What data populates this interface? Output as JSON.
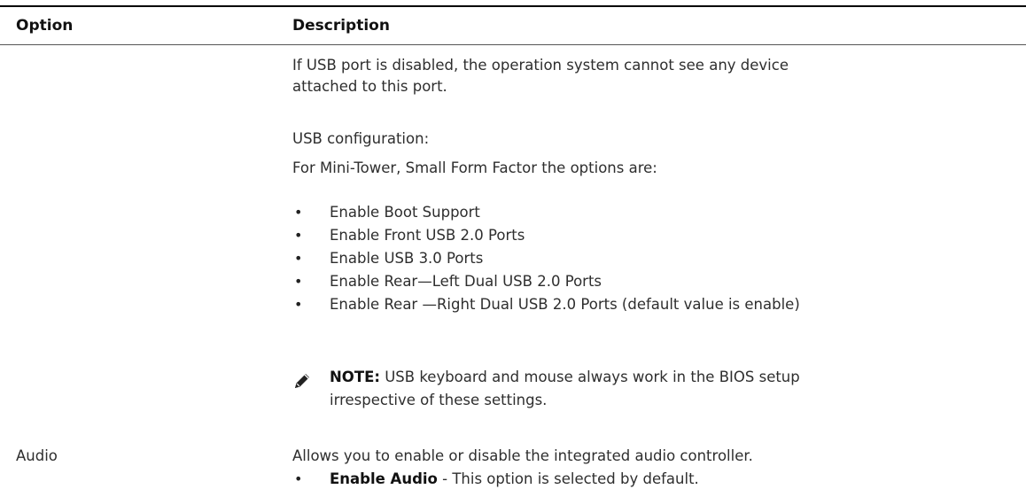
{
  "table": {
    "header": {
      "option": "Option",
      "description": "Description"
    }
  },
  "usb_row": {
    "para1_line1": "If USB port is disabled, the operation system cannot see any device",
    "para1_line2": "attached to this port.",
    "config_label": "USB configuration:",
    "config_intro": "For Mini-Tower, Small Form Factor the options are:",
    "options": [
      "Enable Boot Support",
      "Enable Front USB 2.0 Ports",
      "Enable USB 3.0 Ports",
      "Enable Rear—Left Dual USB 2.0 Ports",
      "Enable Rear —Right Dual USB 2.0 Ports (default value is enable)"
    ],
    "note": {
      "label": "NOTE:",
      "line1": " USB keyboard and mouse always work in the BIOS setup",
      "line2": "irrespective of these settings.",
      "icon": "pencil-icon"
    }
  },
  "audio_row": {
    "option": "Audio",
    "description": "Allows you to enable or disable the integrated audio controller.",
    "bullet_bold": "Enable Audio",
    "bullet_rest": " - This option is selected by default."
  },
  "colors": {
    "text": "#2e2e2e",
    "heading": "#111111",
    "rule": "#000000"
  }
}
